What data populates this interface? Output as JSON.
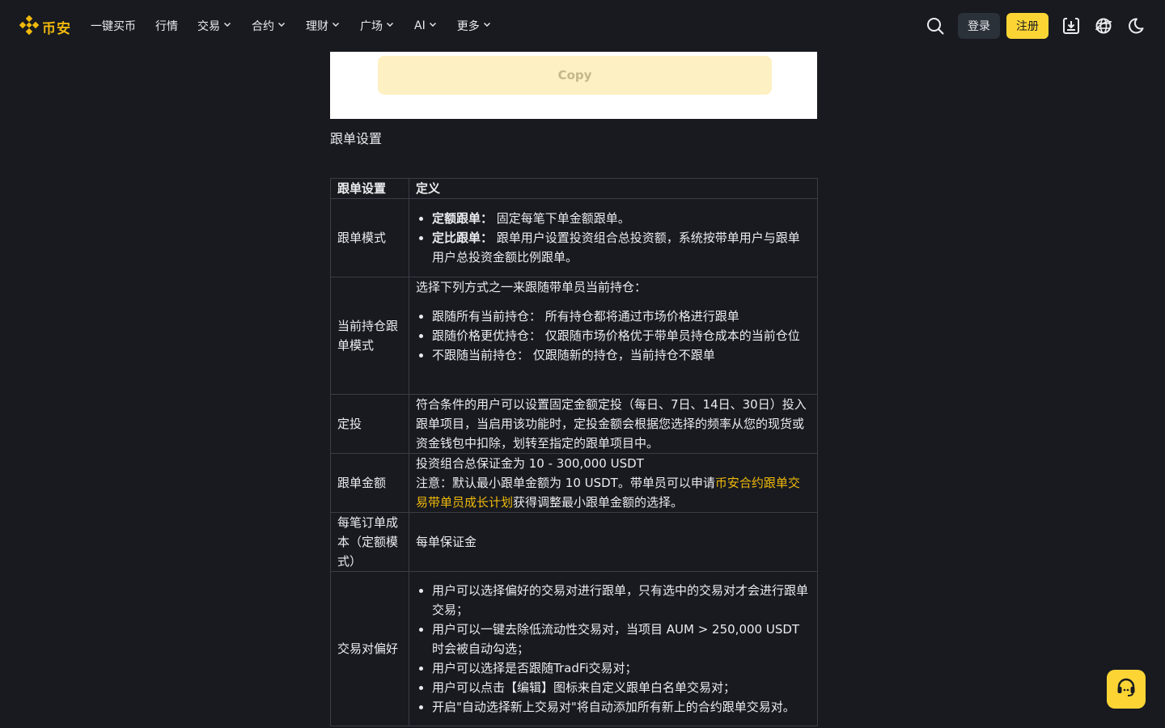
{
  "header": {
    "logo_text": "币安",
    "nav": [
      {
        "label": "一键买币"
      },
      {
        "label": "行情"
      },
      {
        "label": "交易"
      },
      {
        "label": "合约"
      },
      {
        "label": "理财"
      },
      {
        "label": "广场"
      },
      {
        "label": "AI"
      },
      {
        "label": "更多"
      }
    ],
    "login_label": "登录",
    "register_label": "注册",
    "icons": [
      "search-icon",
      "download-icon",
      "globe-icon",
      "moon-icon"
    ]
  },
  "embedded_image": {
    "copy_label": "Copy"
  },
  "section_title": "跟单设置",
  "table": {
    "headers": [
      "跟单设置",
      "定义"
    ],
    "rows": {
      "mode": {
        "name": "跟单模式",
        "items": [
          {
            "bold": "定额跟单：",
            "text": "固定每笔下单金额跟单。"
          },
          {
            "bold": "定比跟单：",
            "text": "跟单用户设置投资组合总投资额，系统按带单用户与跟单用户总投资金额比例跟单。"
          }
        ]
      },
      "position": {
        "name": "当前持仓跟单模式",
        "intro": "选择下列方式之一来跟随带单员当前持仓：",
        "items": [
          "跟随所有当前持仓： 所有持仓都将通过市场价格进行跟单",
          "跟随价格更优持仓： 仅跟随市场价格优于带单员持仓成本的当前仓位",
          "不跟随当前持仓： 仅跟随新的持仓，当前持仓不跟单"
        ]
      },
      "dca": {
        "name": "定投",
        "text": "符合条件的用户可以设置固定金额定投（每日、7日、14日、30日）投入跟单项目，当启用该功能时，定投金额会根据您选择的频率从您的现货或资金钱包中扣除，划转至指定的跟单项目中。"
      },
      "amount": {
        "name": "跟单金额",
        "line1": "投资组合总保证金为 10 - 300,000 USDT",
        "line2_pre": "注意：默认最小跟单金额为 10 USDT。带单员可以申请",
        "link": "币安合约跟单交易带单员成长计划",
        "line2_post": "获得调整最小跟单金额的选择。"
      },
      "cost": {
        "name": "每笔订单成本（定额模式）",
        "text": "每单保证金"
      },
      "pairs": {
        "name": "交易对偏好",
        "items": [
          "用户可以选择偏好的交易对进行跟单，只有选中的交易对才会进行跟单交易；",
          "用户可以一键去除低流动性交易对，当项目 AUM > 250,000 USDT 时会被自动勾选；",
          "用户可以选择是否跟随TradFi交易对；",
          "用户可以点击【编辑】图标来自定义跟单白名单交易对；",
          "开启\"自动选择新上交易对\"将自动添加所有新上的合约跟单交易对。"
        ]
      }
    }
  },
  "support_icon": "headset-icon",
  "colors": {
    "brand": "#f0b90b",
    "register_bg": "#fcd535",
    "background": "#181a20"
  }
}
